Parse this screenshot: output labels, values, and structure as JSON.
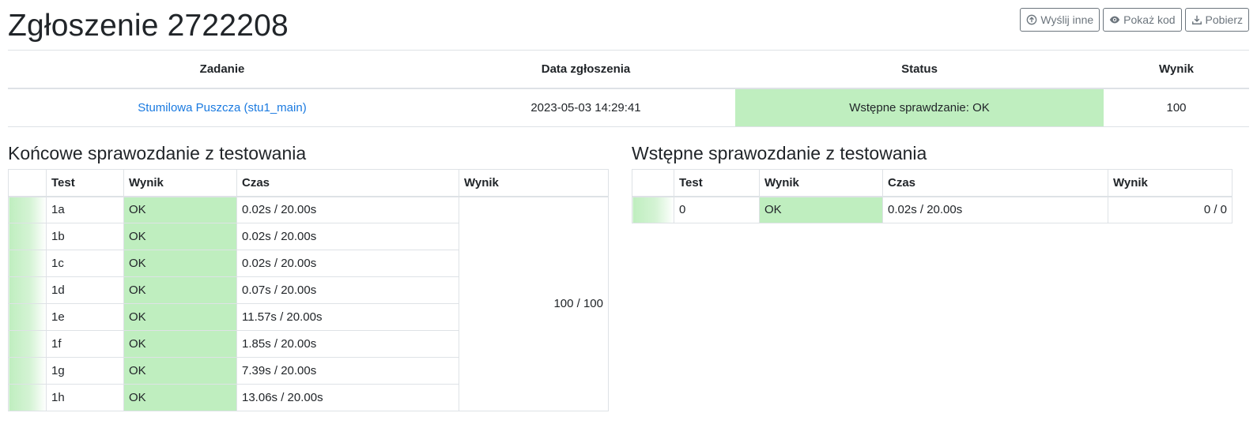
{
  "page_title": "Zgłoszenie 2722208",
  "toolbar": {
    "resubmit_label": "Wyślij inne",
    "show_code_label": "Pokaż kod",
    "download_label": "Pobierz"
  },
  "summary": {
    "headers": [
      "Zadanie",
      "Data zgłoszenia",
      "Status",
      "Wynik"
    ],
    "task": "Stumilowa Puszcza (stu1_main)",
    "date": "2023-05-03 14:29:41",
    "status": "Wstępne sprawdzanie: OK",
    "score": "100"
  },
  "final_report": {
    "title": "Końcowe sprawozdanie z testowania",
    "headers": [
      "",
      "Test",
      "Wynik",
      "Czas",
      "Wynik"
    ],
    "group_score": "100 / 100",
    "rows": [
      {
        "test": "1a",
        "result": "OK",
        "time": "0.02s / 20.00s"
      },
      {
        "test": "1b",
        "result": "OK",
        "time": "0.02s / 20.00s"
      },
      {
        "test": "1c",
        "result": "OK",
        "time": "0.02s / 20.00s"
      },
      {
        "test": "1d",
        "result": "OK",
        "time": "0.07s / 20.00s"
      },
      {
        "test": "1e",
        "result": "OK",
        "time": "11.57s / 20.00s"
      },
      {
        "test": "1f",
        "result": "OK",
        "time": "1.85s / 20.00s"
      },
      {
        "test": "1g",
        "result": "OK",
        "time": "7.39s / 20.00s"
      },
      {
        "test": "1h",
        "result": "OK",
        "time": "13.06s / 20.00s"
      }
    ]
  },
  "initial_report": {
    "title": "Wstępne sprawozdanie z testowania",
    "headers": [
      "",
      "Test",
      "Wynik",
      "Czas",
      "Wynik"
    ],
    "rows": [
      {
        "test": "0",
        "result": "OK",
        "time": "0.02s / 20.00s",
        "score": "0 / 0"
      }
    ]
  },
  "colors": {
    "ok_background": "#bfeebf",
    "link": "#1a7ae0",
    "button_outline": "#6c757d"
  }
}
